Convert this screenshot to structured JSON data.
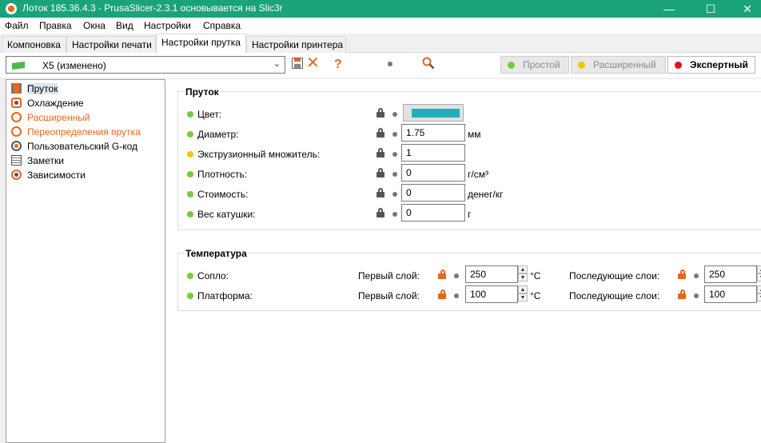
{
  "window": {
    "title": "Лоток 185.36.4.3 - PrusaSlicer-2.3.1 основывается на Slic3r",
    "minimize": "—",
    "maximize": "☐",
    "close": "✕"
  },
  "menu": [
    "Файл",
    "Правка",
    "Окна",
    "Вид",
    "Настройки",
    "Справка"
  ],
  "tabs": [
    "Компоновка",
    "Настройки печати",
    "Настройки прутка",
    "Настройки принтера"
  ],
  "active_tab": "Настройки прутка",
  "toolbar": {
    "preset": "X5 (изменено)",
    "modes": [
      "Простой",
      "Расширенный",
      "Экспертный"
    ],
    "active_mode": "Экспертный",
    "mode_colors": [
      "#6fcf3a",
      "#f2c40f",
      "#e01414"
    ]
  },
  "sidebar": [
    {
      "label": "Пруток",
      "icon": "filament-spool-icon",
      "selected": true,
      "modified": false
    },
    {
      "label": "Охлаждение",
      "icon": "fan-icon",
      "selected": false,
      "modified": false
    },
    {
      "label": "Расширенный",
      "icon": "gears-icon",
      "selected": false,
      "modified": true
    },
    {
      "label": "Переопределения прутка",
      "icon": "gears-icon",
      "selected": false,
      "modified": true
    },
    {
      "label": "Пользовательский G-код",
      "icon": "gcode-gear-icon",
      "selected": false,
      "modified": false
    },
    {
      "label": "Заметки",
      "icon": "notes-icon",
      "selected": false,
      "modified": false
    },
    {
      "label": "Зависимости",
      "icon": "dependencies-icon",
      "selected": false,
      "modified": false
    }
  ],
  "filament": {
    "title": "Пруток",
    "color_label": "Цвет:",
    "color_value": "#1fb1b7",
    "diameter_label": "Диаметр:",
    "diameter": "1.75",
    "diameter_unit": "мм",
    "extrusion_label": "Экструзионный множитель:",
    "extrusion": "1",
    "density_label": "Плотность:",
    "density": "0",
    "density_unit": "г/см³",
    "cost_label": "Стоимость:",
    "cost": "0",
    "cost_unit": "денег/кг",
    "spool_label": "Вес катушки:",
    "spool": "0",
    "spool_unit": "г"
  },
  "temperature": {
    "title": "Температура",
    "nozzle_label": "Сопло:",
    "bed_label": "Платформа:",
    "first_layer_label": "Первый слой:",
    "other_layers_label": "Последующие слои:",
    "nozzle_first": "250",
    "nozzle_other": "250",
    "bed_first": "100",
    "bed_other": "100",
    "unit": "°C"
  }
}
